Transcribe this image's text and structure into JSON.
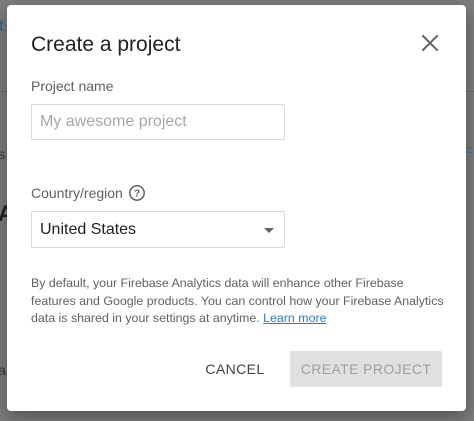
{
  "dialog": {
    "title": "Create a project",
    "close_icon": "close-icon"
  },
  "project_name": {
    "label": "Project name",
    "placeholder": "My awesome project",
    "value": ""
  },
  "country": {
    "label": "Country/region",
    "help_icon": "help-icon",
    "selected": "United States"
  },
  "description": {
    "text": "By default, your Firebase Analytics data will enhance other Firebase features and Google products. You can control how your Firebase Analytics data is shared in your settings at anytime.",
    "link": "Learn more"
  },
  "actions": {
    "cancel_label": "CANCEL",
    "create_label": "CREATE PROJECT"
  },
  "background": {
    "frag_t": "t",
    "frag_s": "s",
    "frag_a": "A",
    "frag_e": "=",
    "frag_dash": "a"
  },
  "colors": {
    "overlay": "#7d7d7d",
    "dialog_bg": "#ffffff",
    "link": "#2b7bd9",
    "disabled_button_bg": "#e0e0e0",
    "disabled_button_text": "#9e9e9e"
  }
}
